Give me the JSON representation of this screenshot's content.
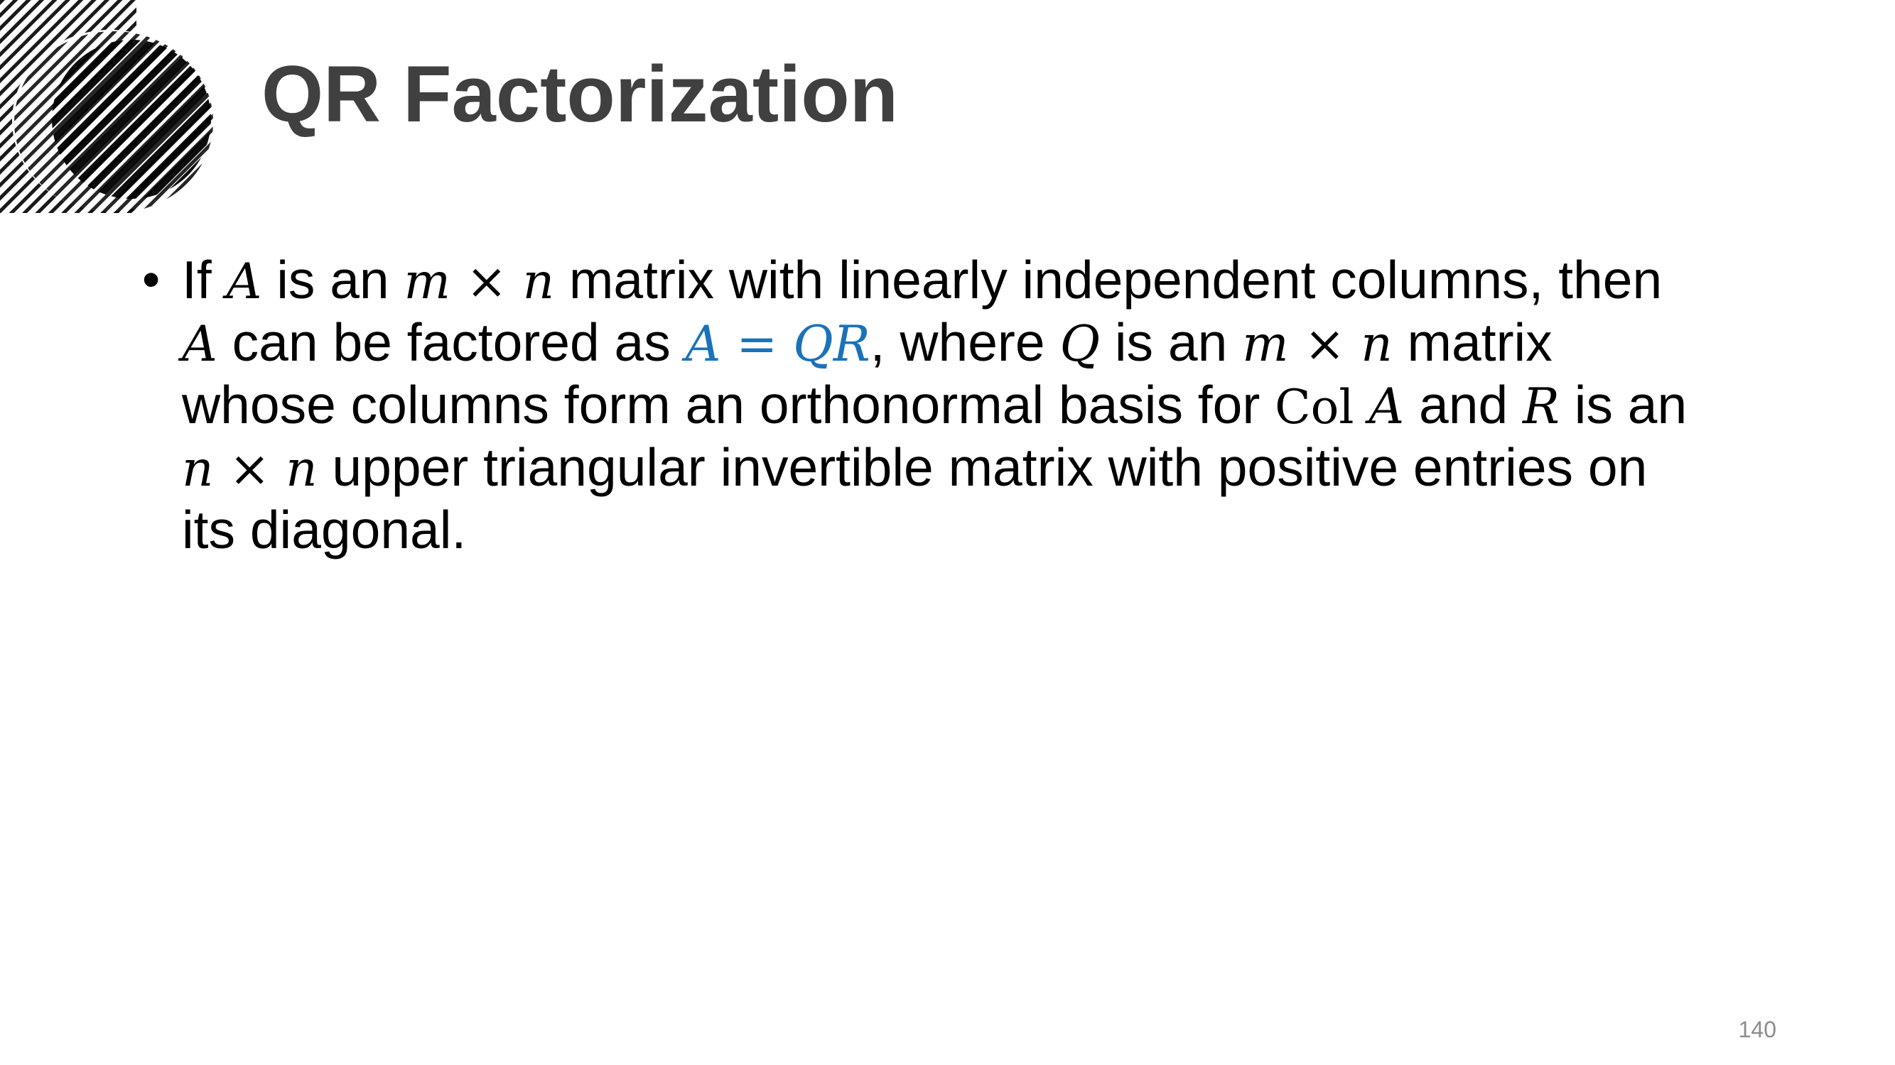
{
  "slide": {
    "title": "QR Factorization",
    "page_number": "140",
    "accent_color": "#1a72bb",
    "title_color": "#404040",
    "decoration_icon": "diagonal-hatched-circles-icon"
  },
  "bullet": {
    "marker": "•",
    "lines": [
      [
        {
          "t": "If ",
          "s": "text"
        },
        {
          "t": "A",
          "s": "math"
        },
        {
          "t": " is an ",
          "s": "text"
        },
        {
          "t": "m",
          "s": "math"
        },
        {
          "t": " × ",
          "s": "op"
        },
        {
          "t": "n",
          "s": "math"
        },
        {
          "t": " matrix with linearly independent columns, then",
          "s": "text"
        }
      ],
      [
        {
          "t": "A",
          "s": "math"
        },
        {
          "t": " can be factored as ",
          "s": "text"
        },
        {
          "t": "A",
          "s": "math-accent"
        },
        {
          "t": " = ",
          "s": "op-accent"
        },
        {
          "t": "QR",
          "s": "math-accent"
        },
        {
          "t": ", where ",
          "s": "text"
        },
        {
          "t": "Q",
          "s": "math"
        },
        {
          "t": " is an ",
          "s": "text"
        },
        {
          "t": "m",
          "s": "math"
        },
        {
          "t": " × ",
          "s": "op"
        },
        {
          "t": "n",
          "s": "math"
        },
        {
          "t": " matrix",
          "s": "text"
        }
      ],
      [
        {
          "t": "whose columns form an orthonormal basis for ",
          "s": "text"
        },
        {
          "t": "Col",
          "s": "roman"
        },
        {
          "t": " ",
          "s": "text"
        },
        {
          "t": "A",
          "s": "math"
        },
        {
          "t": " and ",
          "s": "text"
        },
        {
          "t": "R",
          "s": "math"
        },
        {
          "t": " is an",
          "s": "text"
        }
      ],
      [
        {
          "t": "n",
          "s": "math"
        },
        {
          "t": " × ",
          "s": "op"
        },
        {
          "t": "n",
          "s": "math"
        },
        {
          "t": " upper triangular invertible matrix with positive entries on",
          "s": "text"
        }
      ],
      [
        {
          "t": "its diagonal.",
          "s": "text"
        }
      ]
    ]
  }
}
